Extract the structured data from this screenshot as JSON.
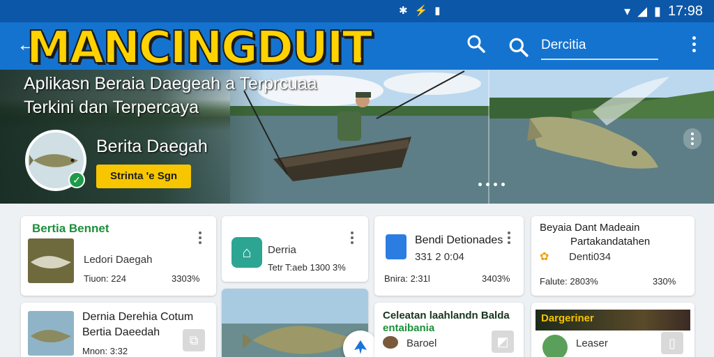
{
  "status": {
    "time": "17:98"
  },
  "header": {
    "brand": "MANCINGDUIT",
    "search_value": "Dercitia"
  },
  "hero": {
    "tagline_line1": "Aplikasn Beraia Daegeah a Terprcuaa",
    "tagline_line2": "Terkini dan Terpercaya",
    "profile_name": "Berita Daegah",
    "button_label": "Strinta 'e Sgn"
  },
  "cards": {
    "c1": {
      "title": "Bertia Bennet",
      "line1": "Ledori Daegah",
      "meta_left": "Tiuon: 224",
      "meta_right": "3303%"
    },
    "c2": {
      "title": "Derria",
      "meta": "Tetr T:aeb 1300 3%"
    },
    "c3": {
      "title": "Bendi Detionades",
      "sub": "331 2 0:04",
      "meta_left": "Bnira: 2:31l",
      "meta_right": "3403%"
    },
    "c4": {
      "title_line1": "Beyaia Dant Madeain",
      "title_line2": "Partakandatahen",
      "sub": "Denti034",
      "meta_left": "Falute: 2803%",
      "meta_right": "330%"
    },
    "c5": {
      "title_line1": "Dernia Derehia Cotum",
      "title_line2": "Bertia Daeedah",
      "meta": "Mnon: 3:32"
    },
    "c7": {
      "title_line1": "Celeatan laahlandn Balda",
      "title_line2": "entaibania",
      "sub": "Baroel"
    },
    "c8": {
      "banner": "Dargeriner",
      "sub": "Leaser"
    }
  },
  "colors": {
    "appbar": "#1473cf",
    "statusbar": "#0d57a8",
    "brand_yellow": "#ffd200",
    "accent_green": "#1d8f3a"
  }
}
